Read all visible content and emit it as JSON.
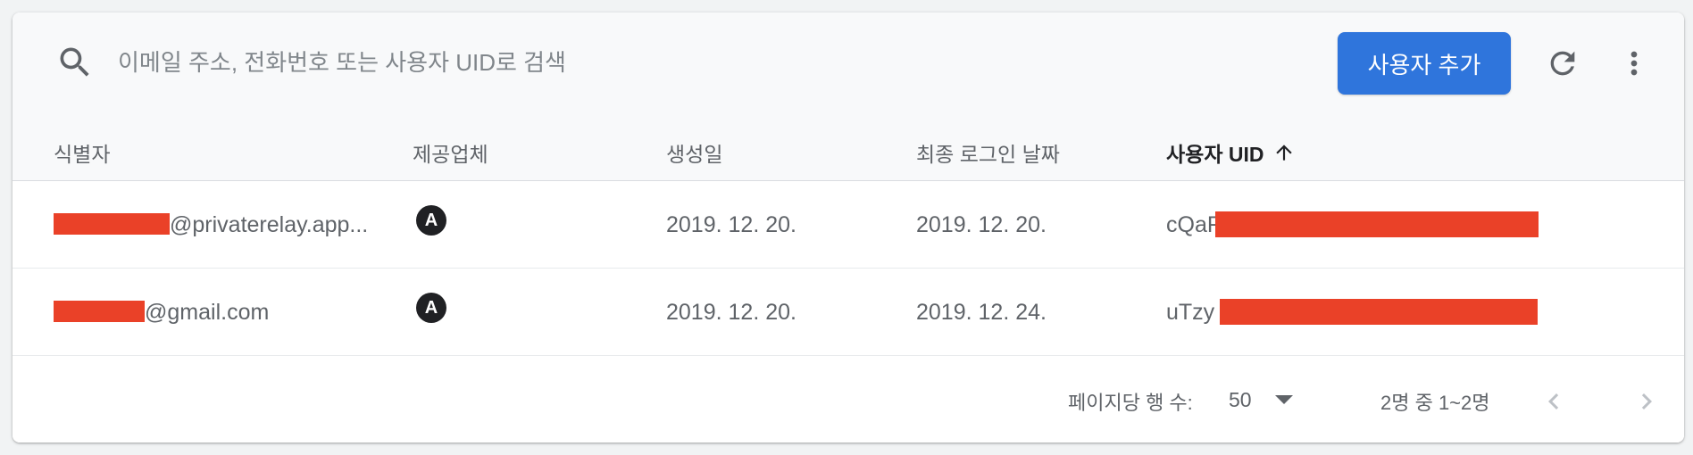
{
  "search": {
    "placeholder": "이메일 주소, 전화번호 또는 사용자 UID로 검색",
    "value": ""
  },
  "toolbar": {
    "add_user_label": "사용자 추가",
    "refresh_icon": "refresh-icon",
    "more_icon": "more-vert-icon"
  },
  "table": {
    "columns": [
      {
        "label": "식별자"
      },
      {
        "label": "제공업체"
      },
      {
        "label": "생성일"
      },
      {
        "label": "최종 로그인 날짜"
      },
      {
        "label": "사용자 UID",
        "sorted": "ascending"
      }
    ],
    "rows": [
      {
        "identifier_suffix": "@privaterelay.app...",
        "provider_icon": "apple-provider-icon",
        "provider_glyph": "A",
        "created": "2019. 12. 20.",
        "last_login": "2019. 12. 20.",
        "uid_prefix": "cQaF"
      },
      {
        "identifier_suffix": "@gmail.com",
        "provider_icon": "apple-provider-icon",
        "provider_glyph": "A",
        "created": "2019. 12. 20.",
        "last_login": "2019. 12. 24.",
        "uid_prefix": "uTzy"
      }
    ]
  },
  "pagination": {
    "rows_per_page_label": "페이지당 행 수:",
    "rows_per_page_value": "50",
    "range_text": "2명 중 1~2명"
  },
  "colors": {
    "accent": "#2f75dc",
    "redaction": "#ea4128",
    "text_muted": "#5f6368",
    "text_dark": "#202124"
  }
}
